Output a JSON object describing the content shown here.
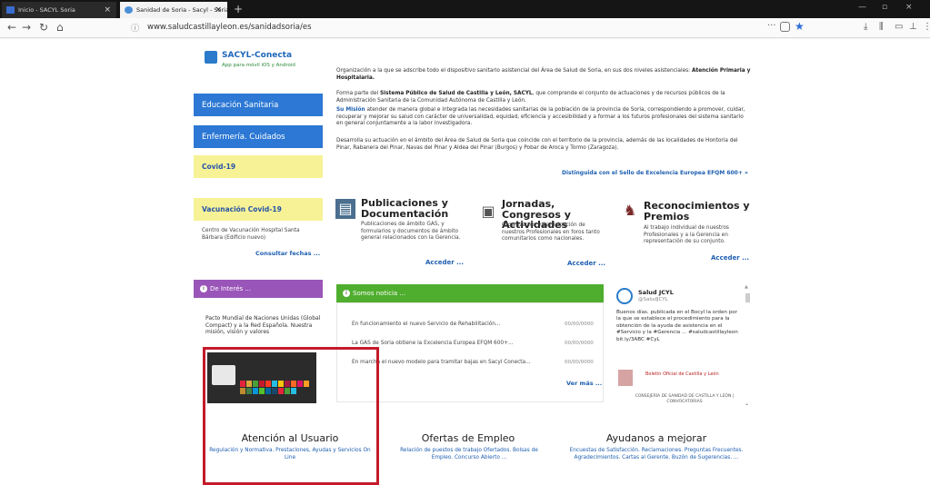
{
  "browser": {
    "tabs": [
      {
        "label": "Inicio - SACYL Soria",
        "active": false
      },
      {
        "label": "Sanidad de Soria - Sacyl - Soria",
        "active": true
      }
    ],
    "new_tab_icon": "plus-icon",
    "url": "www.saludcastillayleon.es/sanidadsoria/es"
  },
  "app_promo": {
    "title": "SACYL-Conecta",
    "subtitle": "App para móvil iOS y Android"
  },
  "sidebar": {
    "buttons": [
      {
        "label": "Educación Sanitaria",
        "style": "blue"
      },
      {
        "label": "Enfermería. Cuidados",
        "style": "blue"
      },
      {
        "label": "Covid-19",
        "style": "yellow"
      },
      {
        "label": "Vacunación Covid-19",
        "style": "yellow"
      }
    ],
    "note": "Centro de Vacunación Hospital Santa Bárbara (Edificio nuevo)",
    "note_link": "Consultar fechas ..."
  },
  "intro": {
    "p1": "Organización a la que se adscribe todo el dispositivo sanitario asistencial del Área de Salud de Soria, en sus dos niveles asistenciales:",
    "p1_bold": "Atención Primaria y Hospitalaria.",
    "p2_pre": "Forma parte del",
    "p2_bold": "Sistema Público de Salud de Castilla y León, SACYL",
    "p2_post": ", que comprende el conjunto de actuaciones y de recursos públicos de la Administración Sanitaria de la Comunidad Autónoma de Castilla y León.",
    "p3_bold": "Su Misión",
    "p3": "atender de manera global e integrada las necesidades sanitarias de la población de la provincia de Soria, correspondiendo a promover, cuidar, recuperar y mejorar su salud con carácter de universalidad, equidad, eficiencia y accesibilidad y a formar a los futuros profesionales del sistema sanitario en general conjuntamente a la labor investigadora.",
    "p4": "Desarrolla su actuación en el ámbito del Área de Salud de Soria que coincide con el territorio de la provincia, además de las localidades de Hontoria del Pinar, Rabanera del Pinar, Navas del Pinar y Aldea del Pinar (Burgos) y Pobar de Aroca y Tormo (Zaragoza).",
    "award": "Distinguida con el Sello de Excelencia Europea EFQM 600+ »"
  },
  "features": [
    {
      "title": "Publicaciones y Documentación",
      "desc": "Publicaciones de ámbito GAS, y formularios y documentos de ámbito general relacionados con la Gerencia.",
      "link": "Acceder ...",
      "icon": "documents-icon"
    },
    {
      "title": "Jornadas, Congresos y Actividades",
      "desc": "Organización y participación de nuestros Profesionales en foros tanto comunitarios como nacionales.",
      "link": "Acceder ...",
      "icon": "conference-icon"
    },
    {
      "title": "Reconocimientos y Premios",
      "desc": "Al trabajo individual de nuestros Profesionales y a la Gerencia en representación de su conjunto.",
      "link": "Acceder ...",
      "icon": "award-icon"
    }
  ],
  "interes": {
    "header": "De Interés ...",
    "text": "Pacto Mundial de Naciones Unidas (Global Compact) y a la Red Española. Nuestra misión, visión y valores"
  },
  "news": {
    "header": "Somos noticia ...",
    "items": [
      {
        "text": "En funcionamiento el nuevo Servicio de Rehabilitación...",
        "date": "00/00/0000"
      },
      {
        "text": "La GAS de Soria obtiene la Excelencia Europea EFQM 600+...",
        "date": "00/00/0000"
      },
      {
        "text": "En marcha el nuevo modelo para tramitar bajas en Sacyl Conecta...",
        "date": "00/00/0000"
      }
    ],
    "more": "Ver más ..."
  },
  "twitter": {
    "name": "Salud JCYL",
    "handle": "@SaludJCYL",
    "text": "Buenos días. publicada en el Bocyl la orden por la que se establece el procedimiento para la obtención de la ayuda de asistencia en el #Servicio y la #Gerencia ... #saludcastillayleon bit.ly/3ABC #CyL",
    "bocyl": "Boletín Oficial de Castilla y León",
    "caption": "CONSEJERÍA DE SANIDAD DE CASTILLA Y LEÓN | CONVOCATORIAS"
  },
  "bottom": [
    {
      "title": "Atención al Usuario",
      "links": "Regulación y Normativa. Prestaciones, Ayudas y Servicios On Line"
    },
    {
      "title": "Ofertas de Empleo",
      "links": "Relación de puestos de trabajo Ofertados. Bolsas de Empleo. Concurso Abierto ..."
    },
    {
      "title": "Ayudanos a mejorar",
      "links": "Encuestas de Satisfacción. Reclamaciones. Preguntas Frecuentes. Agradecimientos. Cartas al Gerente. Buzón de Sugerencias. ..."
    }
  ],
  "colors": {
    "brand_blue": "#2c78d4",
    "covid_yellow": "#f7f296",
    "interes_purple": "#9a55b8",
    "news_green": "#4fae2e",
    "highlight_red": "#c41a2a"
  }
}
